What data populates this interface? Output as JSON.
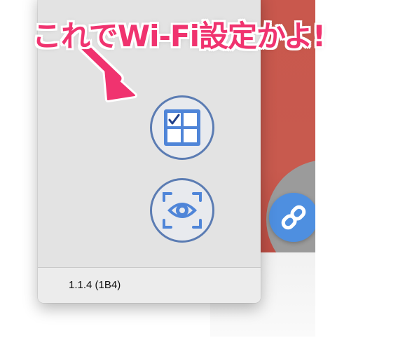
{
  "annotation": {
    "text": "これでWi-Fi設定かよ!"
  },
  "panel": {
    "version": "1.1.4 (1B4)",
    "buttons": [
      {
        "icon": "grid-check-icon"
      },
      {
        "icon": "eye-scan-icon"
      }
    ]
  },
  "background": {
    "badge_icon": "link-icon"
  },
  "colors": {
    "annotation": "#f0336f",
    "button_border": "#5b7cb3",
    "icon": "#4f85d8",
    "bg_window": "#c85a4e",
    "badge": "#4e8fe0"
  }
}
